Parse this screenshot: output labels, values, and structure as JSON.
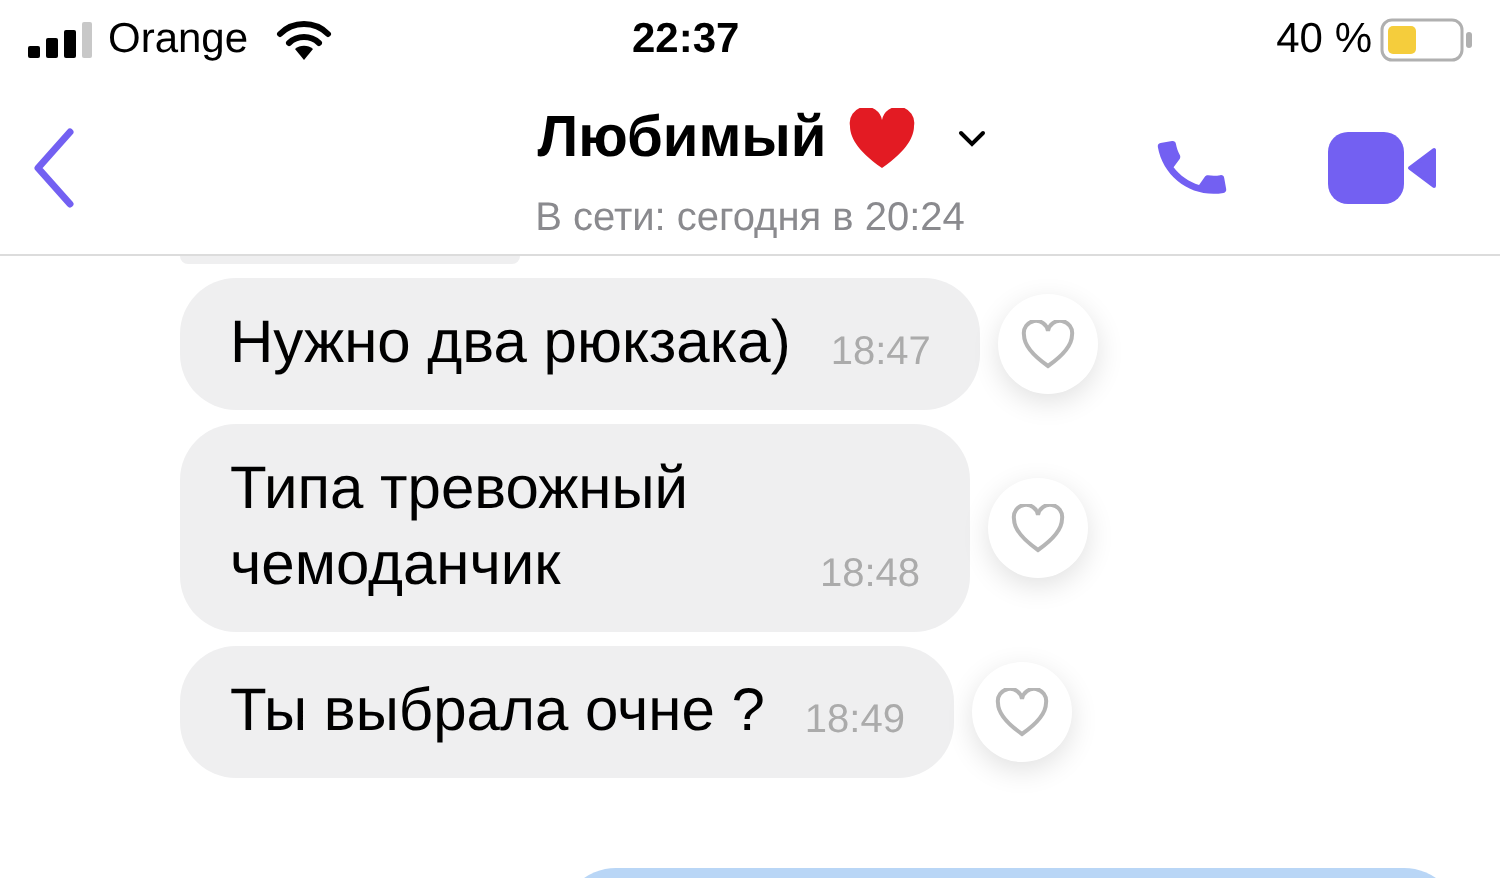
{
  "status_bar": {
    "carrier": "Orange",
    "time": "22:37",
    "battery": "40 %"
  },
  "header": {
    "title": "Любимый",
    "subtitle": "В сети: сегодня в 20:24"
  },
  "messages": [
    {
      "text": "Нужно два рюкзака)",
      "time": "18:47",
      "liked": false
    },
    {
      "text": "Типа тревожный чемоданчик",
      "time": "18:48",
      "liked": false
    },
    {
      "text": "Ты выбрала очне ?",
      "time": "18:49",
      "liked": false
    }
  ]
}
